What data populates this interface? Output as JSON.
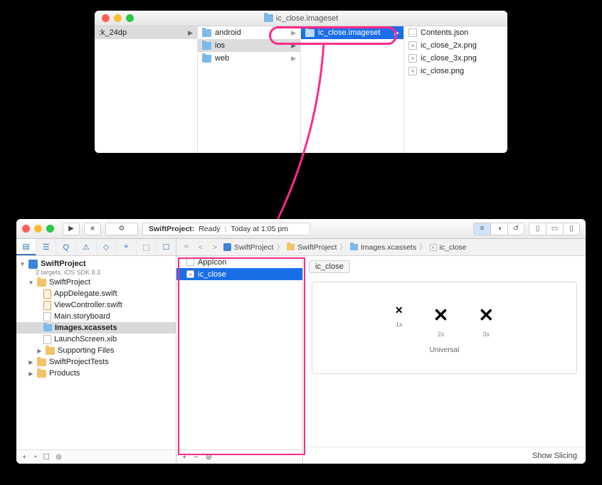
{
  "finder": {
    "title": "ic_close.imageset",
    "col0": [
      {
        "label": ":k_24dp",
        "arrow": true
      }
    ],
    "col1": [
      {
        "label": "android",
        "arrow": true,
        "selected": false
      },
      {
        "label": "ios",
        "arrow": true,
        "selected": true
      },
      {
        "label": "web",
        "arrow": true,
        "selected": false
      }
    ],
    "col2": [
      {
        "label": "ic_close.imageset",
        "arrow": true,
        "selected": true
      }
    ],
    "col3": [
      {
        "label": "Contents.json",
        "kind": "file"
      },
      {
        "label": "ic_close_2x.png",
        "kind": "img"
      },
      {
        "label": "ic_close_3x.png",
        "kind": "img"
      },
      {
        "label": "ic_close.png",
        "kind": "img"
      }
    ]
  },
  "xcode": {
    "status_project": "SwiftProject:",
    "status_state": "Ready",
    "status_time": "Today at 1:05 pm",
    "breadcrumbs": [
      {
        "label": "SwiftProject"
      },
      {
        "label": "SwiftProject"
      },
      {
        "label": "Images.xcassets"
      },
      {
        "label": "ic_close"
      }
    ],
    "project_name": "SwiftProject",
    "project_sub": "2 targets, iOS SDK 8.3",
    "tree": {
      "group": "SwiftProject",
      "files": [
        "AppDelegate.swift",
        "ViewController.swift",
        "Main.storyboard",
        "Images.xcassets",
        "LaunchScreen.xib"
      ],
      "supporting": "Supporting Files",
      "tests": "SwiftProjectTests",
      "products": "Products"
    },
    "assets": [
      {
        "label": "AppIcon",
        "selected": false
      },
      {
        "label": "ic_close",
        "selected": true
      }
    ],
    "detail_title": "ic_close",
    "slots": [
      "1x",
      "2x",
      "3x"
    ],
    "universal": "Universal",
    "show_slicing": "Show Slicing"
  }
}
